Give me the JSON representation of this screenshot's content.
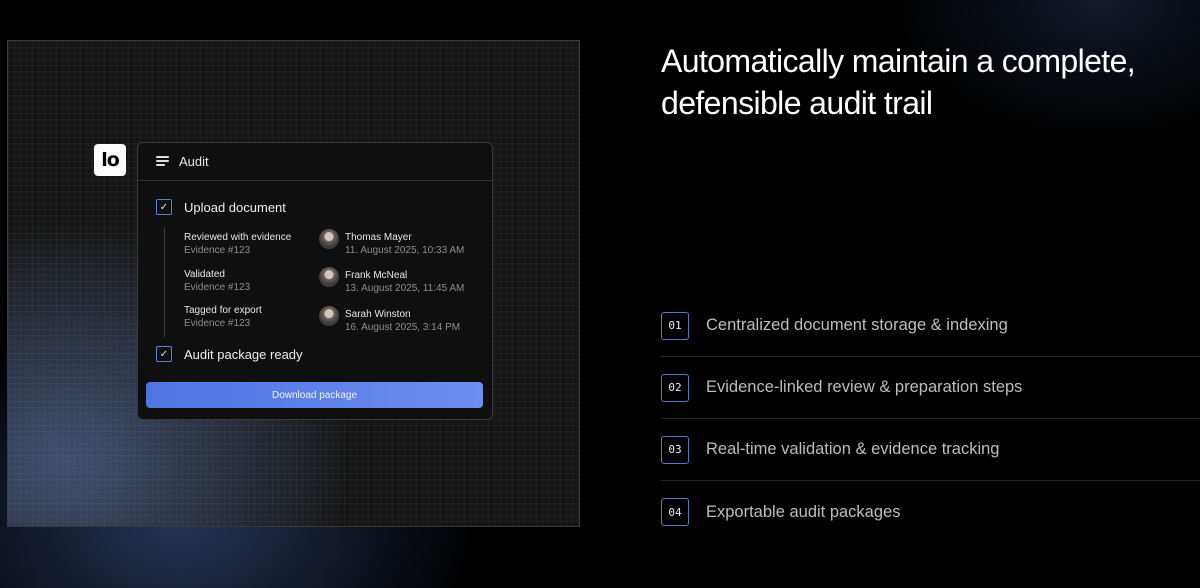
{
  "logo": {
    "text": "lo"
  },
  "audit_card": {
    "title": "Audit",
    "steps": [
      {
        "label": "Upload document"
      },
      {
        "label": "Audit package ready"
      }
    ],
    "events": [
      {
        "action": "Reviewed with evidence",
        "evidence": "Evidence #123",
        "user": "Thomas Mayer",
        "date": "11. August 2025, 10:33 AM"
      },
      {
        "action": "Validated",
        "evidence": "Evidence #123",
        "user": "Frank McNeal",
        "date": "13. August 2025, 11:45 AM"
      },
      {
        "action": "Tagged for export",
        "evidence": "Evidence #123",
        "user": "Sarah Winston",
        "date": "16. August 2025, 3:14 PM"
      }
    ],
    "download_label": "Download package"
  },
  "headline": "Automatically maintain a complete, defensible audit trail",
  "features": [
    {
      "num": "01",
      "text": "Centralized document storage & indexing"
    },
    {
      "num": "02",
      "text": "Evidence-linked review & preparation steps"
    },
    {
      "num": "03",
      "text": "Real-time validation & evidence tracking"
    },
    {
      "num": "04",
      "text": "Exportable audit packages"
    }
  ]
}
